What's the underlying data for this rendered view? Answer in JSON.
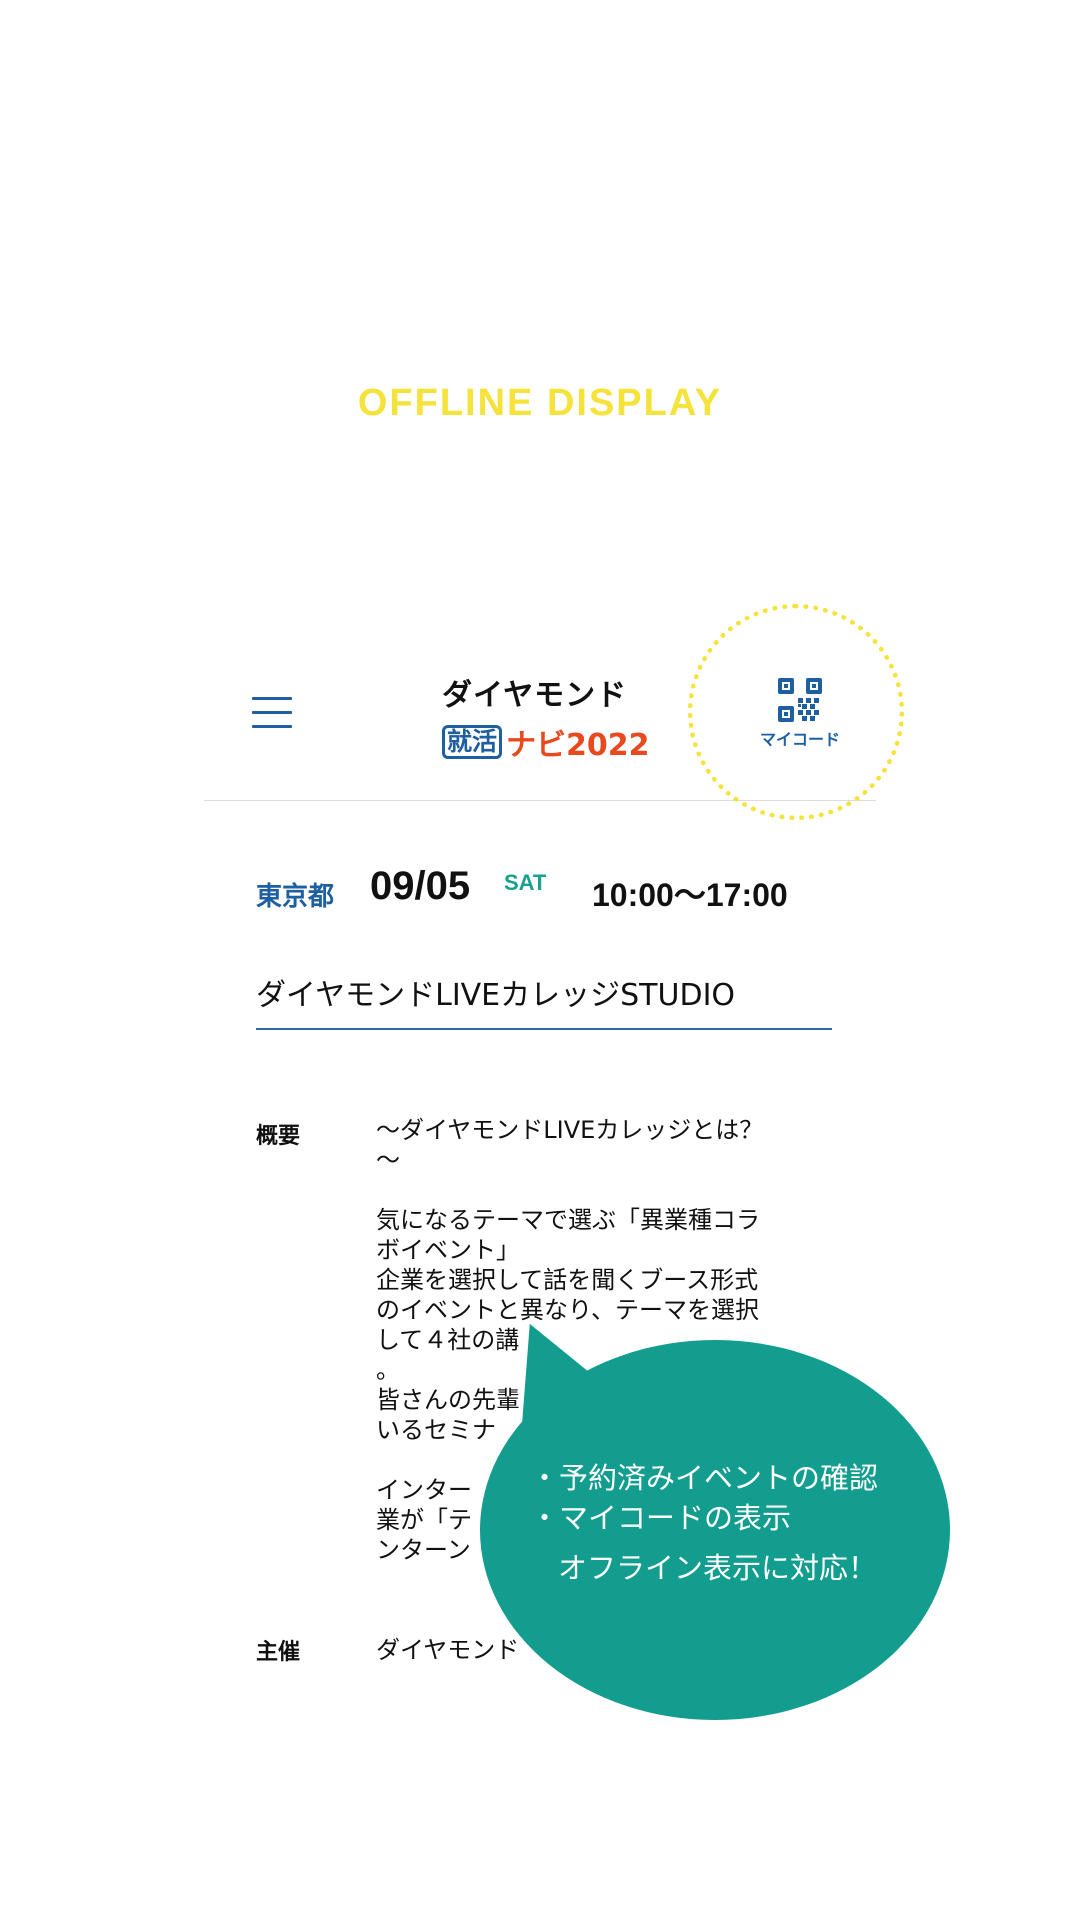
{
  "hero": {
    "title": "OFFLINE DISPLAY"
  },
  "header": {
    "logo": {
      "line1": "ダイヤモンド",
      "badge": "就活",
      "navi": "ナビ2022"
    },
    "mycode_label": "マイコード",
    "icons": [
      "menu-icon",
      "qr-code-icon"
    ]
  },
  "event": {
    "prefecture": "東京都",
    "date": "09/05",
    "day_of_week": "SAT",
    "time": "10:00〜17:00",
    "venue": "ダイヤモンドLIVEカレッジSTUDIO",
    "summary_label": "概要",
    "summary_text": "〜ダイヤモンドLIVEカレッジとは？\n〜\n\n気になるテーマで選ぶ「異業種コラ\nボイベント」\n企業を選択して話を聞くブース形式\nのイベントと異なり、テーマを選択\nして４社の講\n。\n皆さんの先輩\nいるセミナ\n\nインター\n業が「テ\nンターン",
    "organizer_label": "主催",
    "organizer_text": "ダイヤモンド"
  },
  "callout": {
    "line1": "・予約済みイベントの確認",
    "line2": "・マイコードの表示",
    "line3": "オフライン表示に対応！"
  },
  "colors": {
    "accent_yellow": "#f5e23a",
    "brand_blue": "#1d5fa0",
    "teal": "#139d8f",
    "logo_orange": "#e8491e"
  }
}
